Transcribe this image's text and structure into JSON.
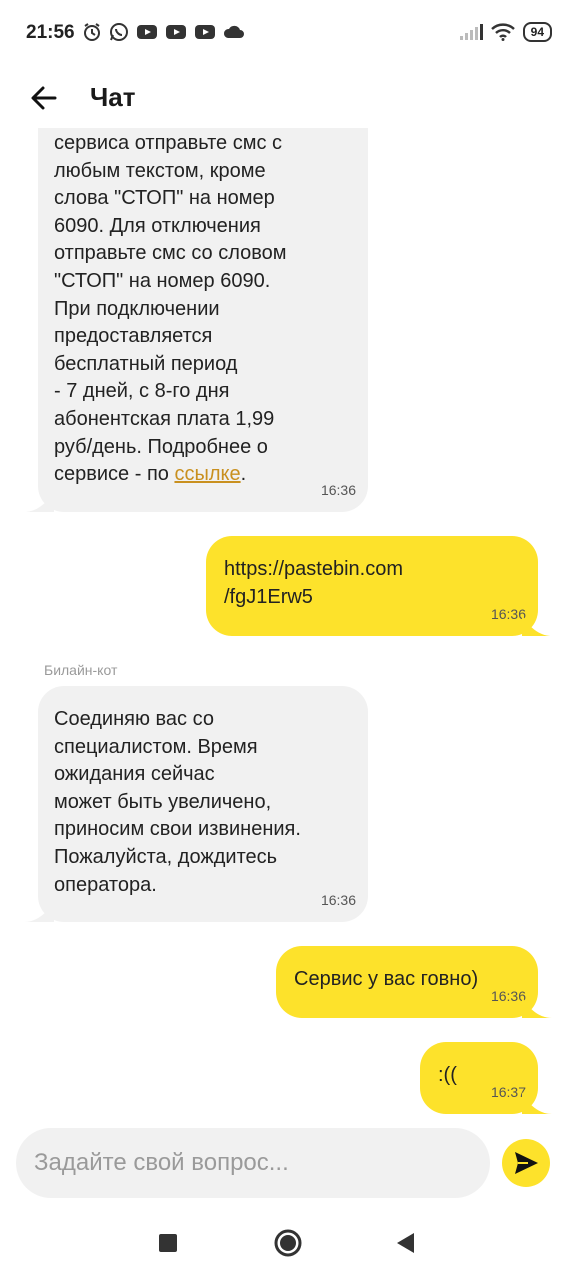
{
  "status_bar": {
    "time": "21:56",
    "battery": "94",
    "icons_left": [
      "alarm-icon",
      "whatsapp-icon",
      "youtube-icon",
      "youtube-icon",
      "youtube-icon",
      "cloud-icon"
    ],
    "icons_right": [
      "signal-icon",
      "wifi-icon",
      "battery-icon"
    ]
  },
  "header": {
    "back_icon": "arrow-left-icon",
    "title": "Чат"
  },
  "messages": [
    {
      "direction": "in",
      "text_lines": "сервиса отправьте смс с\nлюбым текстом, кроме\nслова \"СТОП\" на номер\n6090. Для отключения\nотправьте смс со словом\n\"СТОП\" на номер 6090.\nПри подключении\nпредоставляется\nбесплатный период\n- 7 дней, с 8-го дня\nабонентская плата 1,99\nруб/день. Подробнее о",
      "last_line_prefix": "сервисе - по ",
      "link_text": "ссылке",
      "last_line_suffix": ".",
      "time": "16:36"
    },
    {
      "direction": "out",
      "text": "https://pastebin.com\n/fgJ1Erw5",
      "time": "16:36"
    },
    {
      "direction": "in",
      "sender": "Билайн-кот",
      "text": "Соединяю вас со\nспециалистом. Время\nожидания сейчас\nможет быть увеличено,\nприносим свои извинения.\nПожалуйста, дождитесь\nоператора.",
      "time": "16:36"
    },
    {
      "direction": "out",
      "text": "Сервис у вас говно)",
      "time": "16:36"
    },
    {
      "direction": "out",
      "text": ":((",
      "time": "16:37"
    }
  ],
  "input": {
    "placeholder": "Задайте свой вопрос...",
    "value": ""
  },
  "send_icon": "send-icon",
  "nav": {
    "items": [
      "recents-square-icon",
      "home-circle-icon",
      "back-triangle-icon"
    ]
  },
  "colors": {
    "accent": "#fde22b",
    "incoming_bubble": "#f1f1f1",
    "link": "#c9901f"
  }
}
